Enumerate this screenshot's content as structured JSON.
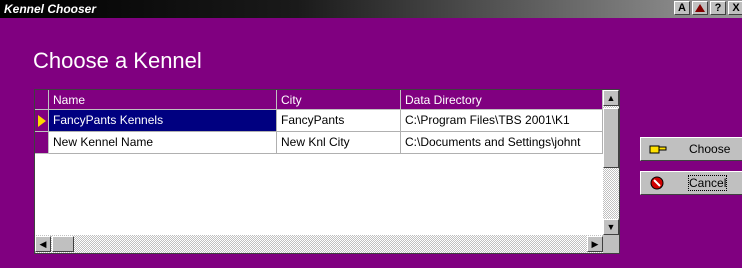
{
  "window": {
    "title": "Kennel Chooser"
  },
  "titlebar_buttons": [
    "A",
    "▶",
    "?",
    "X"
  ],
  "heading": "Choose a Kennel",
  "table": {
    "columns": [
      "Name",
      "City",
      "Data Directory"
    ],
    "rows": [
      {
        "name": "FancyPants Kennels",
        "city": "FancyPants",
        "dir": "C:\\Program Files\\TBS 2001\\K1",
        "selected": true
      },
      {
        "name": "New Kennel Name",
        "city": "New Knl City",
        "dir": "C:\\Documents and Settings\\johnt",
        "selected": false
      }
    ]
  },
  "buttons": {
    "choose": "Choose",
    "cancel": "Cancel"
  },
  "colors": {
    "background": "#800080",
    "selection": "#000080"
  }
}
